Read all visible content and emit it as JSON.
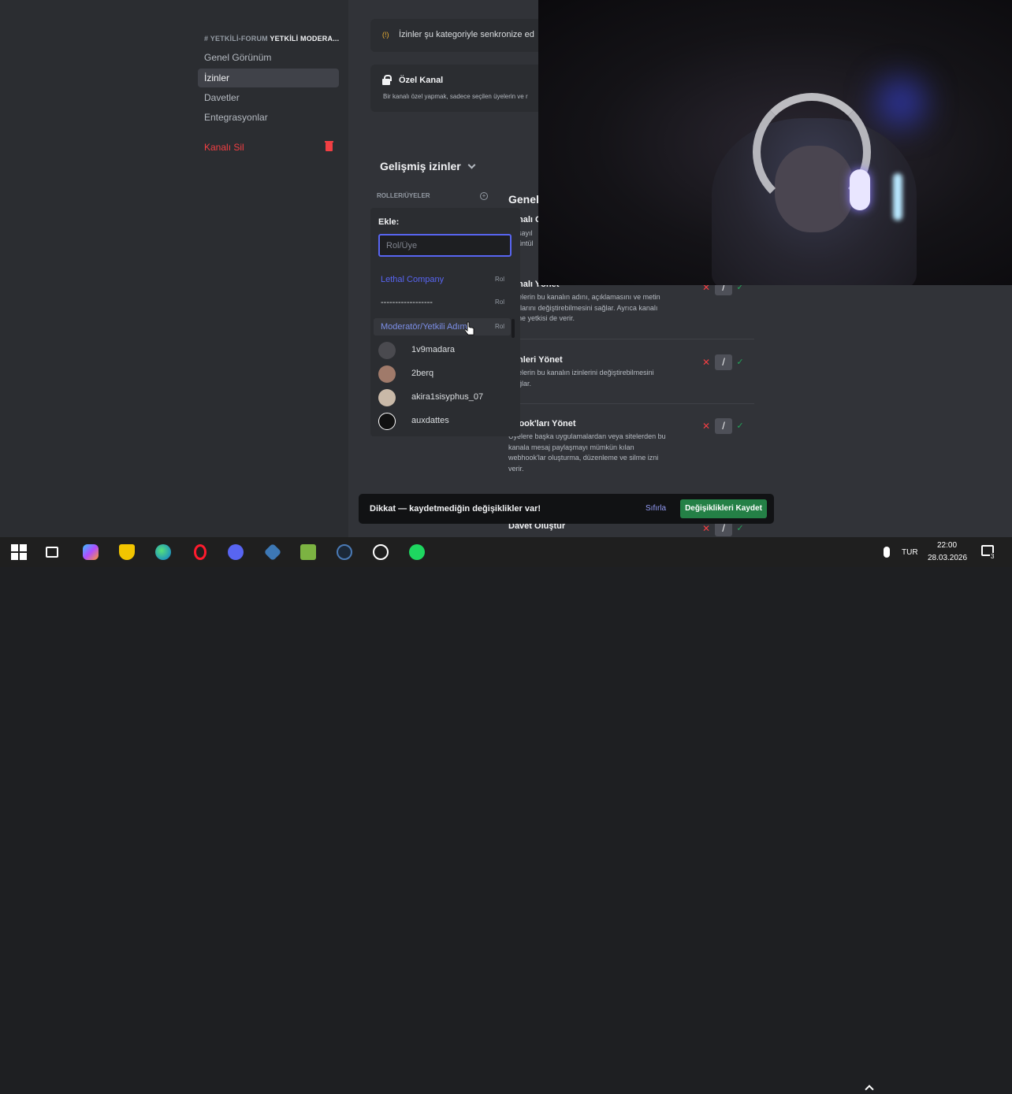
{
  "sidebar": {
    "channel_header_prefix": "# YETKİLİ-FORUM",
    "channel_header_strong": "YETKİLİ MODERA...",
    "items": [
      {
        "label": "Genel Görünüm"
      },
      {
        "label": "İzinler"
      },
      {
        "label": "Davetler"
      },
      {
        "label": "Entegrasyonlar"
      }
    ],
    "delete_label": "Kanalı Sil"
  },
  "sync_card": {
    "text": "İzinler şu kategoriyle senkronize ed"
  },
  "private_card": {
    "title": "Özel Kanal",
    "desc": "Bir kanalı özel yapmak, sadece seçilen üyelerin ve r"
  },
  "advanced": {
    "title": "Gelişmiş izinler",
    "roles_label": "ROLLER/ÜYELER"
  },
  "popup": {
    "label": "Ekle:",
    "placeholder": "Rol/Üye",
    "options": [
      {
        "label": "Lethal Company",
        "type": "Rol",
        "color": "#5865f2"
      },
      {
        "label": "------------------",
        "type": "Rol",
        "color": "#dbdee1"
      },
      {
        "label": "Moderatör/Yetkili Adım",
        "type": "Rol",
        "color": "#7c8fe8"
      }
    ],
    "members": [
      {
        "name": "1v9madara",
        "avatar_color": "#4a4a4f"
      },
      {
        "name": "2berq",
        "avatar_color": "#a07a6a"
      },
      {
        "name": "akira1sisyphus_07",
        "avatar_color": "#c9b9a8"
      },
      {
        "name": "auxdattes",
        "avatar_color": "#111111"
      }
    ]
  },
  "right_panel": {
    "title": "Genel",
    "partial_lines": [
      "nalı G",
      "sayıl",
      "üntül"
    ]
  },
  "permissions": [
    {
      "title": "nalı Yönet",
      "desc": "elerin bu kanalın adını, açıklamasını ve metin\nrlarını değiştirebilmesini sağlar. Ayrıca kanalı\nne yetkisi de verir."
    },
    {
      "title": "nleri Yönet",
      "desc": "elerin bu kanalın izinlerini değiştirebilmesini\nğlar."
    },
    {
      "title": "bhook'ları Yönet",
      "desc": "Üyelere başka uygulamalardan veya sitelerden bu\nkanala mesaj paylaşmayı mümkün kılan\nwebhook'lar oluşturma, düzenleme ve silme izni\nverir."
    },
    {
      "title": "Davet Oluştur",
      "desc": ""
    }
  ],
  "permission_controls": {
    "deny": "✕",
    "neutral": "/",
    "allow": "✓"
  },
  "notice": {
    "text": "Dikkat — kaydetmediğin değişiklikler var!",
    "reset": "Sıfırla",
    "save": "Değişiklikleri Kaydet"
  },
  "taskbar": {
    "language": "TUR",
    "time": "22:00",
    "date": "28.03.2026",
    "notification_count": "3"
  }
}
